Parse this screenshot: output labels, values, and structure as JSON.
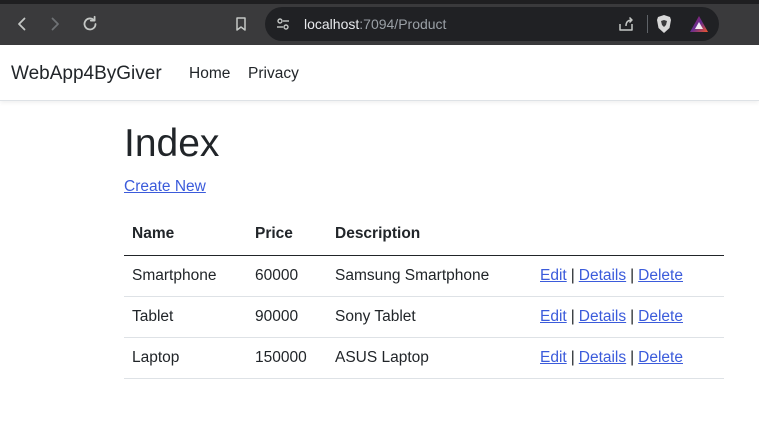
{
  "browser": {
    "url_host": "localhost",
    "url_rest": ":7094/Product",
    "icons": {
      "back": "back-arrow-icon",
      "forward": "forward-arrow-icon",
      "reload": "reload-icon",
      "bookmark": "bookmark-icon",
      "site_settings": "site-settings-icon",
      "share": "share-icon",
      "brave": "brave-shields-icon",
      "rewards": "brave-rewards-icon"
    }
  },
  "navbar": {
    "brand": "WebApp4ByGiver",
    "links": [
      "Home",
      "Privacy"
    ]
  },
  "main": {
    "title": "Index",
    "create_link": "Create New",
    "table": {
      "headers": [
        "Name",
        "Price",
        "Description",
        ""
      ],
      "rows": [
        {
          "name": "Smartphone",
          "price": "60000",
          "description": "Samsung Smartphone"
        },
        {
          "name": "Tablet",
          "price": "90000",
          "description": "Sony Tablet"
        },
        {
          "name": "Laptop",
          "price": "150000",
          "description": "ASUS Laptop"
        }
      ],
      "actions": {
        "edit": "Edit",
        "details": "Details",
        "delete": "Delete",
        "separator": "|"
      }
    }
  },
  "colors": {
    "link": "#3b5bdb",
    "chrome_bg": "#3a3a3c",
    "omnibox_bg": "#202124"
  }
}
